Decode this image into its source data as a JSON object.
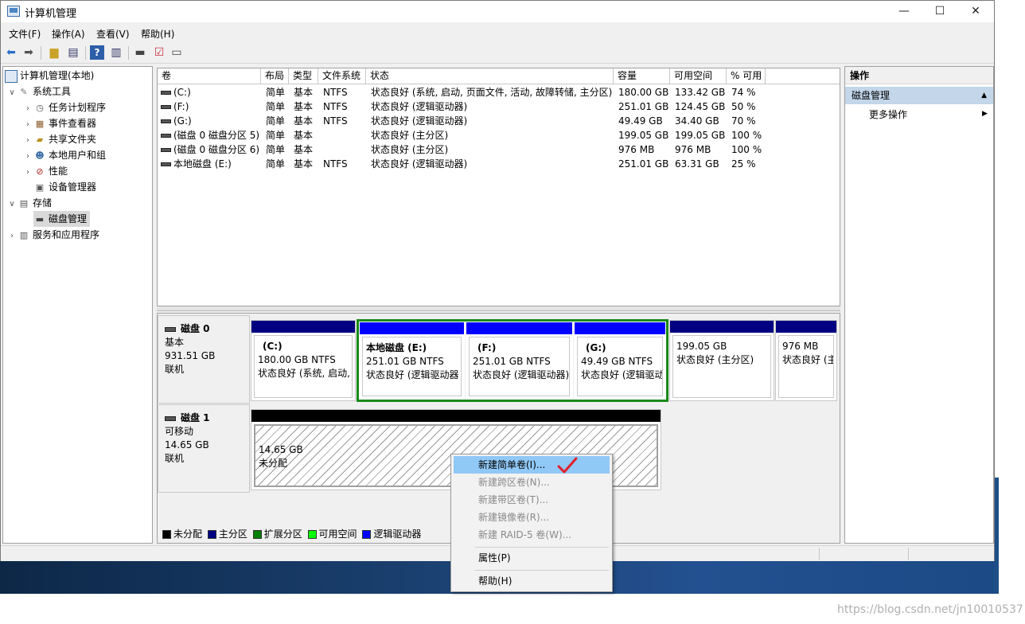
{
  "window": {
    "title": "计算机管理",
    "minimize_glyph": "—",
    "maximize_glyph": "☐",
    "close_glyph": "✕"
  },
  "menu": [
    "文件(F)",
    "操作(A)",
    "查看(V)",
    "帮助(H)"
  ],
  "toolbar": {
    "icons": [
      "back-arrow-icon",
      "forward-arrow-icon",
      "folder-up-icon",
      "show-hide-tree-icon",
      "help-icon",
      "properties-icon",
      "disk-icon",
      "check-icon",
      "console-icon"
    ]
  },
  "tree": {
    "root": "计算机管理(本地)",
    "system_tools": "系统工具",
    "items_tools": [
      "任务计划程序",
      "事件查看器",
      "共享文件夹",
      "本地用户和组",
      "性能",
      "设备管理器"
    ],
    "storage": "存储",
    "disk_mgmt": "磁盘管理",
    "services": "服务和应用程序"
  },
  "volumes": {
    "headers": [
      "卷",
      "布局",
      "类型",
      "文件系统",
      "状态",
      "容量",
      "可用空间",
      "% 可用"
    ],
    "rows": [
      [
        "(C:)",
        "简单",
        "基本",
        "NTFS",
        "状态良好 (系统, 启动, 页面文件, 活动, 故障转储, 主分区)",
        "180.00 GB",
        "133.42 GB",
        "74 %"
      ],
      [
        "(F:)",
        "简单",
        "基本",
        "NTFS",
        "状态良好 (逻辑驱动器)",
        "251.01 GB",
        "124.45 GB",
        "50 %"
      ],
      [
        "(G:)",
        "简单",
        "基本",
        "NTFS",
        "状态良好 (逻辑驱动器)",
        "49.49 GB",
        "34.40 GB",
        "70 %"
      ],
      [
        "(磁盘 0 磁盘分区 5)",
        "简单",
        "基本",
        "",
        "状态良好 (主分区)",
        "199.05 GB",
        "199.05 GB",
        "100 %"
      ],
      [
        "(磁盘 0 磁盘分区 6)",
        "简单",
        "基本",
        "",
        "状态良好 (主分区)",
        "976 MB",
        "976 MB",
        "100 %"
      ],
      [
        "本地磁盘 (E:)",
        "简单",
        "基本",
        "NTFS",
        "状态良好 (逻辑驱动器)",
        "251.01 GB",
        "63.31 GB",
        "25 %"
      ]
    ]
  },
  "disk0": {
    "name": "磁盘 0",
    "kind": "基本",
    "size": "931.51 GB",
    "state": "联机",
    "parts": [
      {
        "l1": "(C:)",
        "l2": "180.00 GB NTFS",
        "l3": "状态良好 (系统, 启动,"
      },
      {
        "l1": "本地磁盘 (E:)",
        "l2": "251.01 GB NTFS",
        "l3": "状态良好 (逻辑驱动器"
      },
      {
        "l1": "(F:)",
        "l2": "251.01 GB NTFS",
        "l3": "状态良好 (逻辑驱动器)"
      },
      {
        "l1": "(G:)",
        "l2": "49.49 GB NTFS",
        "l3": "状态良好 (逻辑驱动"
      },
      {
        "l1": "",
        "l2": "199.05 GB",
        "l3": "状态良好 (主分区)"
      },
      {
        "l1": "",
        "l2": "976 MB",
        "l3": "状态良好 (主"
      }
    ]
  },
  "disk1": {
    "name": "磁盘 1",
    "kind": "可移动",
    "size": "14.65 GB",
    "state": "联机",
    "part": {
      "l1": "14.65 GB",
      "l2": "未分配"
    }
  },
  "legend": [
    {
      "label": "未分配",
      "color": "#000000"
    },
    {
      "label": "主分区",
      "color": "#000080"
    },
    {
      "label": "扩展分区",
      "color": "#008000"
    },
    {
      "label": "可用空间",
      "color": "#00ff00"
    },
    {
      "label": "逻辑驱动器",
      "color": "#0000ff"
    }
  ],
  "actions": {
    "title": "操作",
    "section": "磁盘管理",
    "section_arrow": "▲",
    "more": "更多操作",
    "more_arrow": "▶"
  },
  "context_menu": {
    "items": [
      {
        "label": "新建简单卷(I)...",
        "enabled": true,
        "highlighted": true
      },
      {
        "label": "新建跨区卷(N)...",
        "enabled": false
      },
      {
        "label": "新建带区卷(T)...",
        "enabled": false
      },
      {
        "label": "新建镜像卷(R)...",
        "enabled": false
      },
      {
        "label": "新建 RAID-5 卷(W)...",
        "enabled": false
      },
      {
        "label": "属性(P)",
        "enabled": true
      },
      {
        "label": "帮助(H)",
        "enabled": true
      }
    ]
  },
  "colors": {
    "primary": "#000080",
    "logical": "#0000ff",
    "extended": "#008000",
    "unallocated": "#000000",
    "highlight": "#90c8f6",
    "annotation": "#e0202a"
  },
  "watermark": "https://blog.csdn.net/jn10010537"
}
